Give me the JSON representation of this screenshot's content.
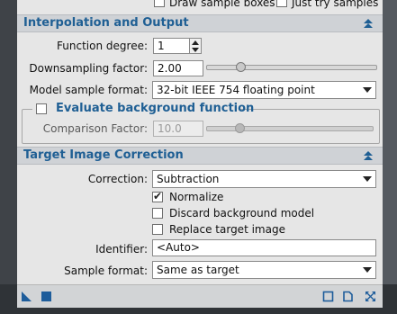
{
  "top": {
    "draw_sample_boxes": {
      "label": "Draw sample boxes",
      "checked": false
    },
    "just_try_samples": {
      "label": "Just try samples",
      "checked": false
    }
  },
  "interpolation": {
    "title": "Interpolation and Output",
    "function_degree": {
      "label": "Function degree:",
      "value": "1"
    },
    "downsampling": {
      "label": "Downsampling factor:",
      "value": "2.00",
      "slider_fraction": 0.2
    },
    "model_sample_format": {
      "label": "Model sample format:",
      "value": "32-bit IEEE 754 floating point"
    }
  },
  "evaluate": {
    "label": "Evaluate background function",
    "checked": false,
    "comparison": {
      "label": "Comparison Factor:",
      "value": "10.0",
      "slider_fraction": 0.2
    }
  },
  "target": {
    "title": "Target Image Correction",
    "correction": {
      "label": "Correction:",
      "value": "Subtraction"
    },
    "normalize": {
      "label": "Normalize",
      "checked": true
    },
    "discard": {
      "label": "Discard background model",
      "checked": false
    },
    "replace": {
      "label": "Replace target image",
      "checked": false
    },
    "identifier": {
      "label": "Identifier:",
      "value": "<Auto>"
    },
    "sample_format": {
      "label": "Sample format:",
      "value": "Same as target"
    }
  },
  "colors": {
    "accent": "#1f5f94",
    "toolbar_blue": "#1e5d9b"
  },
  "icons": [
    "new-instance-icon",
    "apply-global-icon",
    "view-icon",
    "document-icon",
    "reset-icon"
  ]
}
